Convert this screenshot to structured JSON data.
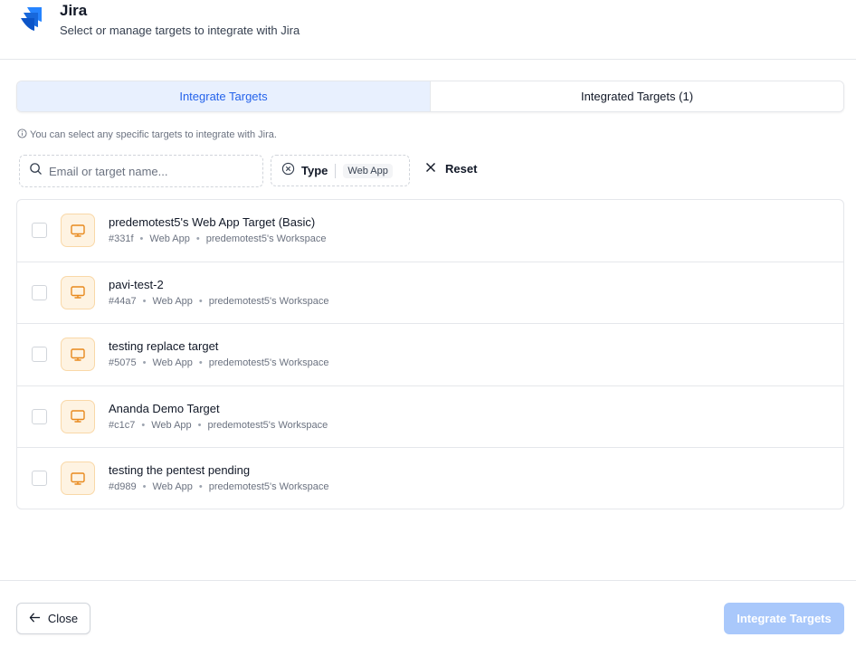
{
  "header": {
    "title": "Jira",
    "subtitle": "Select or manage targets to integrate with Jira",
    "logo_icon": "jira-logo-icon"
  },
  "tabs": [
    {
      "label": "Integrate Targets",
      "active": true
    },
    {
      "label": "Integrated Targets (1)",
      "active": false
    }
  ],
  "hint": "You can select any specific targets to integrate with Jira.",
  "search": {
    "placeholder": "Email or target name...",
    "value": ""
  },
  "filter": {
    "label": "Type",
    "value": "Web App"
  },
  "reset_label": "Reset",
  "targets": [
    {
      "name": "predemotest5's Web App Target (Basic)",
      "id": "#331f",
      "type": "Web App",
      "workspace": "predemotest5's Workspace",
      "checked": false
    },
    {
      "name": "pavi-test-2",
      "id": "#44a7",
      "type": "Web App",
      "workspace": "predemotest5's Workspace",
      "checked": false
    },
    {
      "name": "testing replace target",
      "id": "#5075",
      "type": "Web App",
      "workspace": "predemotest5's Workspace",
      "checked": false
    },
    {
      "name": "Ananda Demo Target",
      "id": "#c1c7",
      "type": "Web App",
      "workspace": "predemotest5's Workspace",
      "checked": false
    },
    {
      "name": "testing the pentest pending",
      "id": "#d989",
      "type": "Web App",
      "workspace": "predemotest5's Workspace",
      "checked": false
    }
  ],
  "footer": {
    "close_label": "Close",
    "integrate_label": "Integrate Targets",
    "integrate_disabled": true
  },
  "colors": {
    "accent": "#2563eb",
    "active_tab_bg": "#e8f0fe",
    "icon_bg": "#fef3e2",
    "icon_stroke": "#e8891d",
    "disabled_button": "#a9c8fb"
  }
}
